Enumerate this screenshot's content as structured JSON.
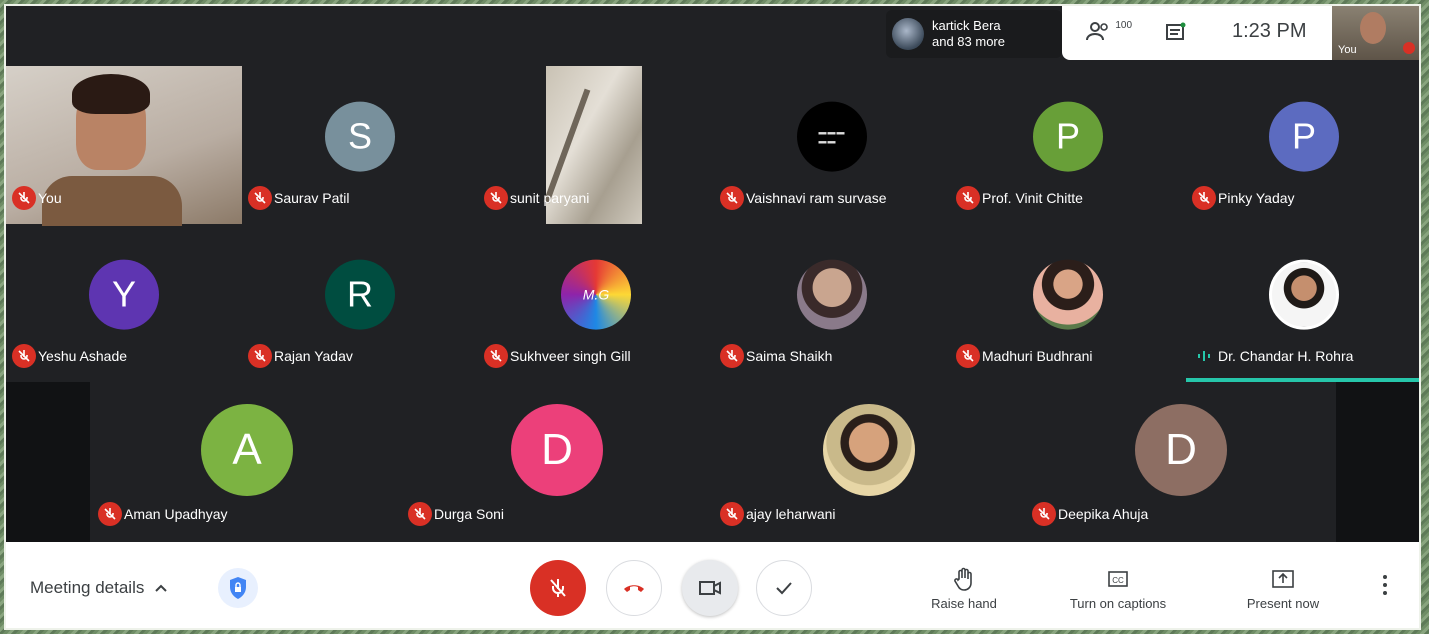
{
  "header": {
    "attendees_line1": "kartick Bera",
    "attendees_line2": "and 83 more",
    "people_count": "100",
    "time": "1:23 PM",
    "self_label": "You"
  },
  "participants_row1": [
    {
      "name": "You",
      "kind": "video"
    },
    {
      "name": "Saurav Patil",
      "initial": "S",
      "color": "#78909c"
    },
    {
      "name": "sunit paryani",
      "kind": "video"
    },
    {
      "name": "Vaishnavi ram survase",
      "kind": "photo"
    },
    {
      "name": "Prof. Vinit Chitte",
      "initial": "P",
      "color": "#689f38"
    },
    {
      "name": "Pinky Yaday",
      "initial": "P",
      "color": "#5c6bc0"
    }
  ],
  "participants_row2": [
    {
      "name": "Yeshu Ashade",
      "initial": "Y",
      "color": "#5e35b1"
    },
    {
      "name": "Rajan Yadav",
      "initial": "R",
      "color": "#004d40"
    },
    {
      "name": "Sukhveer singh Gill",
      "kind": "photo"
    },
    {
      "name": "Saima Shaikh",
      "kind": "photo"
    },
    {
      "name": "Madhuri Budhrani",
      "kind": "photo"
    },
    {
      "name": "Dr. Chandar H. Rohra",
      "kind": "photo"
    }
  ],
  "participants_row3": [
    {
      "name": "Aman Upadhyay",
      "initial": "A",
      "color": "#7cb342"
    },
    {
      "name": "Durga Soni",
      "initial": "D",
      "color": "#ec407a"
    },
    {
      "name": "ajay leharwani",
      "kind": "photo"
    },
    {
      "name": "Deepika Ahuja",
      "initial": "D",
      "color": "#8d6e63"
    }
  ],
  "bottom": {
    "meeting_details": "Meeting details",
    "raise_hand": "Raise hand",
    "captions": "Turn on captions",
    "present": "Present now"
  },
  "colors": {
    "mute_red": "#d93025",
    "speaking_teal": "#26c6aa",
    "bg": "#202124"
  }
}
